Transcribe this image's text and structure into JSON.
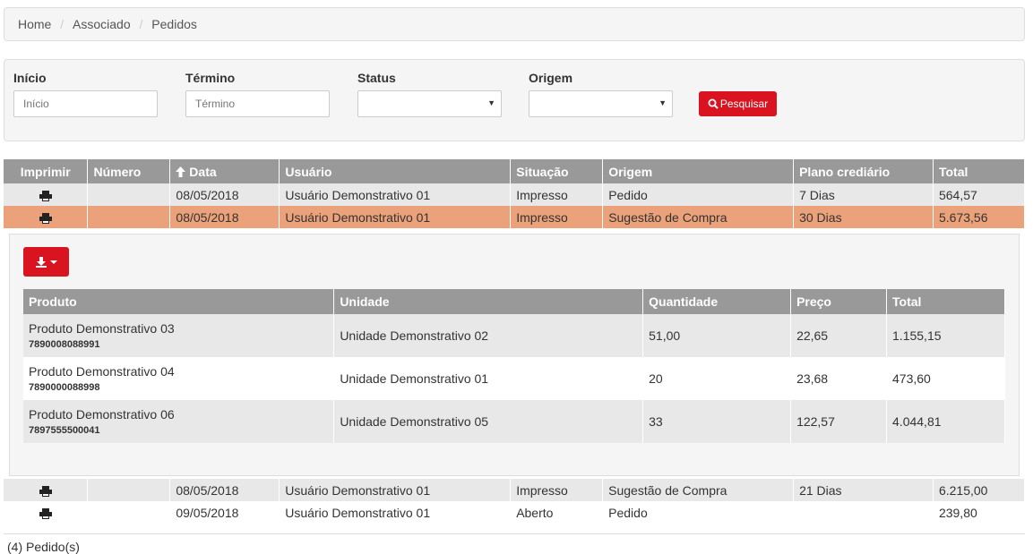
{
  "breadcrumb": [
    "Home",
    "Associado",
    "Pedidos"
  ],
  "breadcrumb_separator": "/",
  "filters": {
    "inicio": {
      "label": "Início",
      "placeholder": "Início"
    },
    "termino": {
      "label": "Término",
      "placeholder": "Término"
    },
    "status": {
      "label": "Status",
      "value": ""
    },
    "origem": {
      "label": "Origem",
      "value": ""
    },
    "search_label": "Pesquisar"
  },
  "orders_table": {
    "headers": {
      "imprimir": "Imprimir",
      "numero": "Número",
      "data": "Data",
      "usuario": "Usuário",
      "situacao": "Situação",
      "origem": "Origem",
      "plano": "Plano crediário",
      "total": "Total"
    },
    "sort_icon": "arrow-up-icon",
    "rows": [
      {
        "numero": "",
        "data": "08/05/2018",
        "usuario": "Usuário Demonstrativo 01",
        "situacao": "Impresso",
        "origem": "Pedido",
        "plano": "7 Dias",
        "total": "564,57"
      },
      {
        "numero": "",
        "data": "08/05/2018",
        "usuario": "Usuário Demonstrativo 01",
        "situacao": "Impresso",
        "origem": "Sugestão de Compra",
        "plano": "30 Dias",
        "total": "5.673,56"
      },
      {
        "numero": "",
        "data": "08/05/2018",
        "usuario": "Usuário Demonstrativo 01",
        "situacao": "Impresso",
        "origem": "Sugestão de Compra",
        "plano": "21 Dias",
        "total": "6.215,00"
      },
      {
        "numero": "",
        "data": "09/05/2018",
        "usuario": "Usuário Demonstrativo 01",
        "situacao": "Aberto",
        "origem": "Pedido",
        "plano": "",
        "total": "239,80"
      }
    ]
  },
  "detail": {
    "download_icon": "download-icon",
    "headers": {
      "produto": "Produto",
      "unidade": "Unidade",
      "quantidade": "Quantidade",
      "preco": "Preço",
      "total": "Total"
    },
    "rows": [
      {
        "produto": "Produto Demonstrativo 03",
        "codigo": "7890008088991",
        "unidade": "Unidade Demonstrativo 02",
        "quantidade": "51,00",
        "preco": "22,65",
        "total": "1.155,15"
      },
      {
        "produto": "Produto Demonstrativo 04",
        "codigo": "7890000088998",
        "unidade": "Unidade Demonstrativo 01",
        "quantidade": "20",
        "preco": "23,68",
        "total": "473,60"
      },
      {
        "produto": "Produto Demonstrativo 06",
        "codigo": "7897555500041",
        "unidade": "Unidade Demonstrativo 05",
        "quantidade": "33",
        "preco": "122,57",
        "total": "4.044,81"
      }
    ]
  },
  "footer": {
    "count_text": "(4) Pedido(s)"
  },
  "colors": {
    "accent_red": "#d9131f",
    "header_gray": "#999999",
    "selected_row": "#eba27a",
    "stripe_gray": "#e8e8e8"
  }
}
